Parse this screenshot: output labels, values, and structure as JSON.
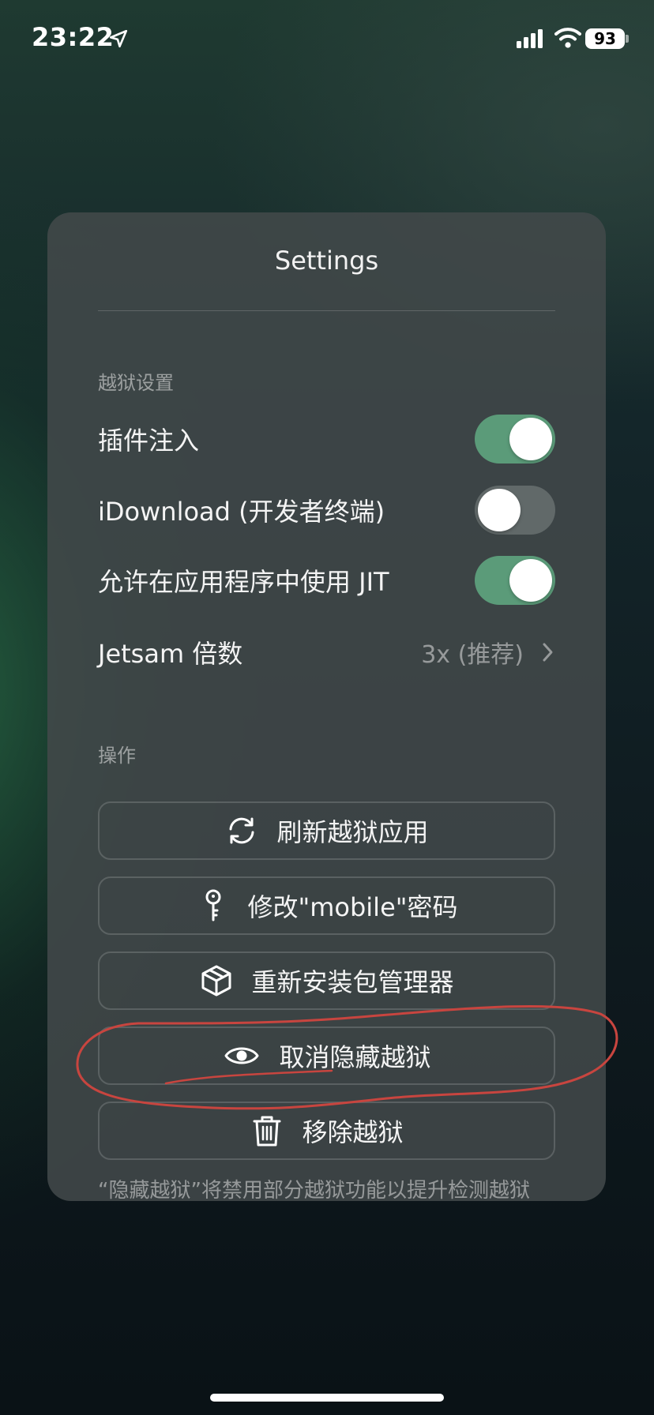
{
  "status_bar": {
    "time": "23:22",
    "battery": "93"
  },
  "panel": {
    "title": "Settings",
    "section1": {
      "header": "越狱设置",
      "rows": [
        {
          "label": "插件注入",
          "toggle": "on"
        },
        {
          "label": "iDownload (开发者终端)",
          "toggle": "off"
        },
        {
          "label": "允许在应用程序中使用 JIT",
          "toggle": "on"
        }
      ],
      "jetsam": {
        "label": "Jetsam 倍数",
        "value": "3x (推荐)"
      }
    },
    "section2": {
      "header": "操作",
      "buttons": [
        {
          "label": "刷新越狱应用",
          "icon": "refresh-icon"
        },
        {
          "label": "修改\"mobile\"密码",
          "icon": "key-icon"
        },
        {
          "label": "重新安装包管理器",
          "icon": "package-icon"
        },
        {
          "label": "取消隐藏越狱",
          "icon": "eye-icon"
        },
        {
          "label": "移除越狱",
          "icon": "trash-icon"
        }
      ]
    },
    "footnote": "“隐藏越狱”将禁用部分越狱功能以提升检测越狱"
  },
  "colors": {
    "toggle_on": "#5b9b79",
    "annotation_stroke": "#c8453f"
  }
}
